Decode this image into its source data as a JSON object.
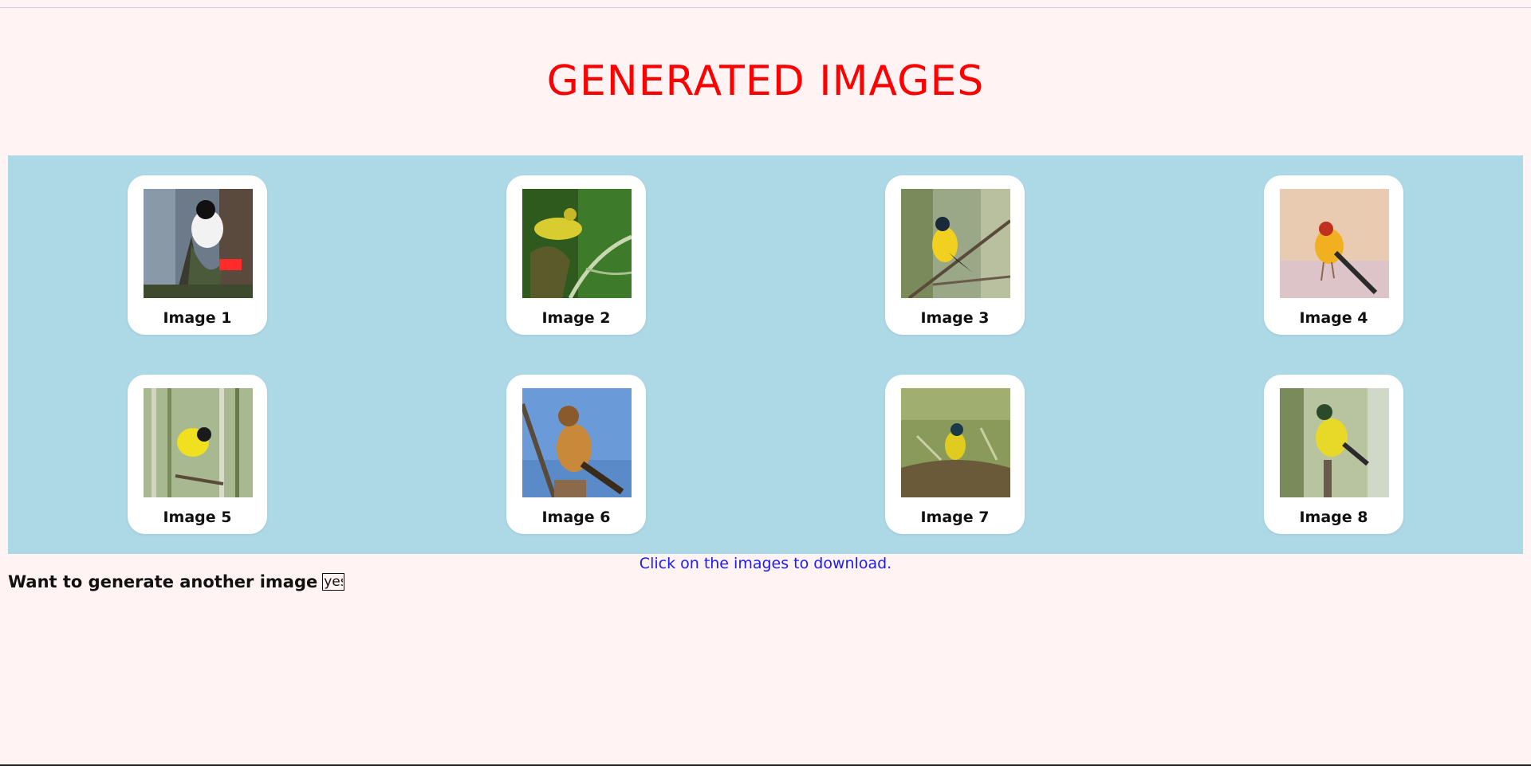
{
  "page": {
    "title": "GENERATED IMAGES",
    "hint": "Click on the images to download.",
    "again_label": "Want to generate another image",
    "again_value": "yes"
  },
  "colors": {
    "background": "#fff3f4",
    "title": "#ff0000",
    "gallery": "#add8e6",
    "hint": "#1a1aff"
  },
  "images": [
    {
      "caption": "Image 1",
      "subject": "black-white-bird-with-red"
    },
    {
      "caption": "Image 2",
      "subject": "yellow-green-bird-on-branch"
    },
    {
      "caption": "Image 3",
      "subject": "yellow-bird-on-twig"
    },
    {
      "caption": "Image 4",
      "subject": "yellow-bird-beige-background"
    },
    {
      "caption": "Image 5",
      "subject": "yellow-bird-in-reeds"
    },
    {
      "caption": "Image 6",
      "subject": "brown-bird-blue-sky"
    },
    {
      "caption": "Image 7",
      "subject": "yellow-bird-in-nest"
    },
    {
      "caption": "Image 8",
      "subject": "yellow-bird-in-foliage"
    }
  ]
}
